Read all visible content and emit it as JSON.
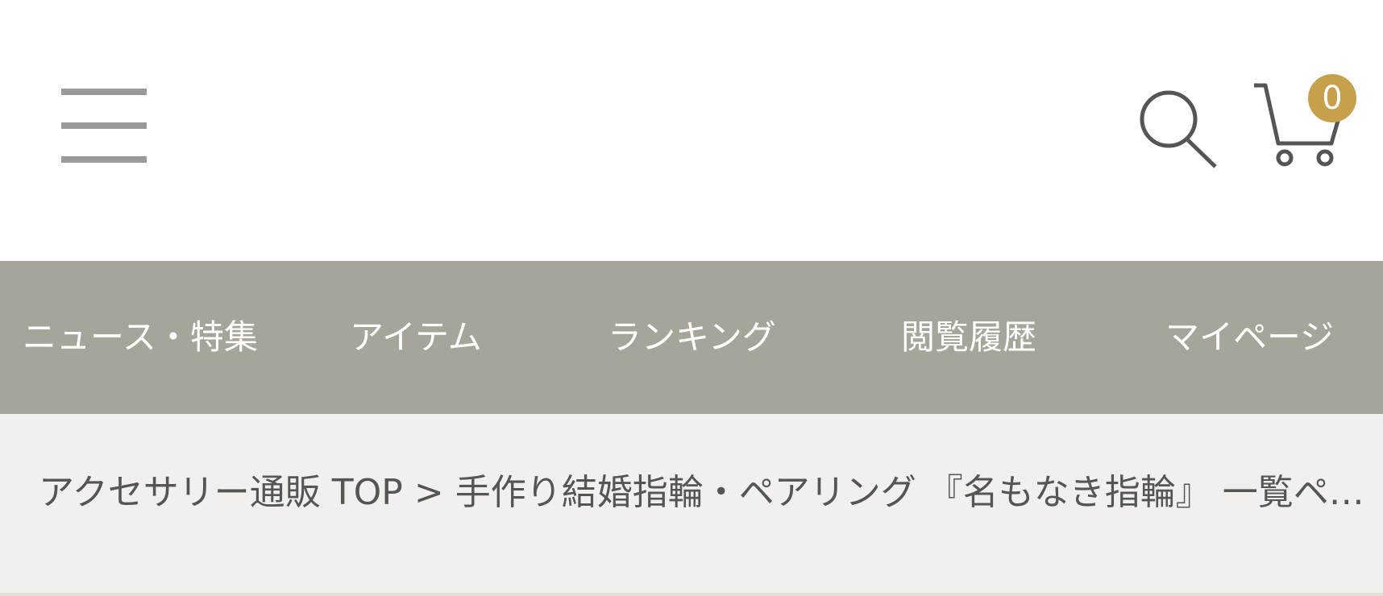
{
  "header": {
    "menu_icon": "hamburger-menu-icon",
    "search_icon": "search-icon",
    "cart_icon": "cart-icon",
    "cart_count": "0",
    "accent_color": "#c6a04a"
  },
  "nav": {
    "background": "#a7a59a",
    "items": [
      {
        "label": "ニュース・特集"
      },
      {
        "label": "アイテム"
      },
      {
        "label": "ランキング"
      },
      {
        "label": "閲覧履歴"
      },
      {
        "label": "マイページ"
      }
    ]
  },
  "breadcrumb": {
    "home": "アクセサリー通販 TOP",
    "separator": ">",
    "current": "手作り結婚指輪・ペアリング 『名もなき指輪』 一覧ページ"
  }
}
